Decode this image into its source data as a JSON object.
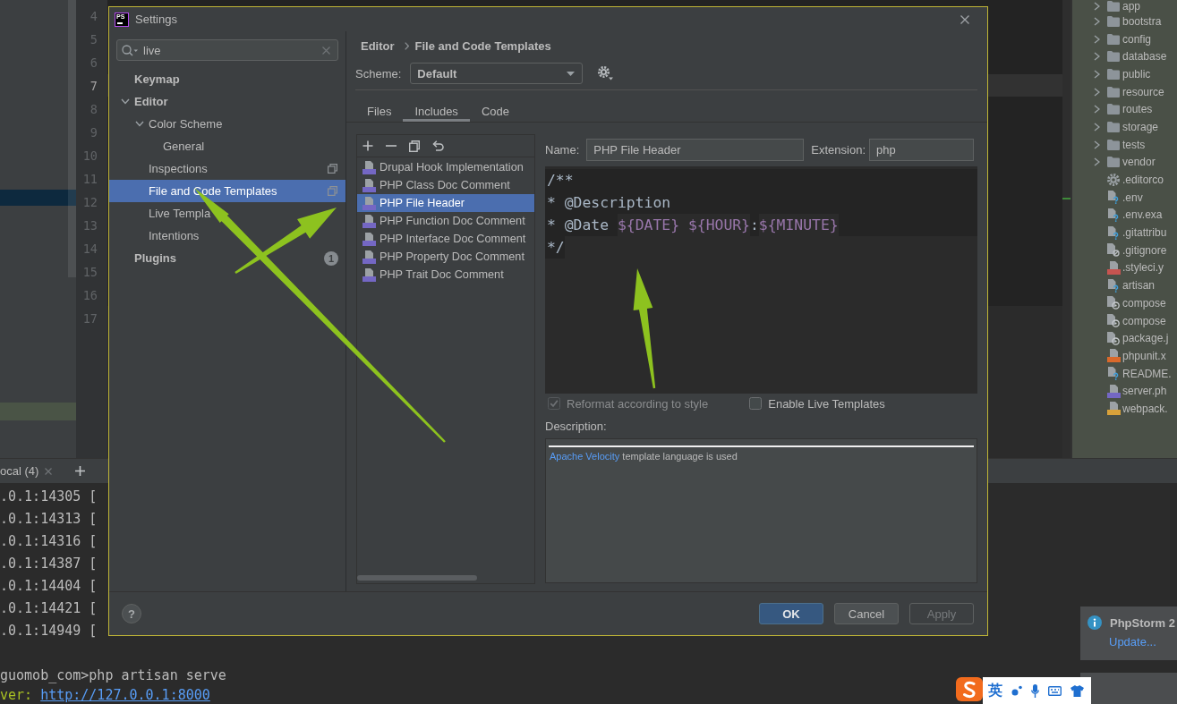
{
  "ide": {
    "gutter": {
      "line_numbers": [
        {
          "number": "4",
          "current": false
        },
        {
          "number": "5",
          "current": false
        },
        {
          "number": "6",
          "current": false
        },
        {
          "number": "7",
          "current": true
        },
        {
          "number": "8",
          "current": false
        },
        {
          "number": "9",
          "current": false
        },
        {
          "number": "10",
          "current": false
        },
        {
          "number": "11",
          "current": false
        },
        {
          "number": "12",
          "current": false
        },
        {
          "number": "13",
          "current": false
        },
        {
          "number": "14",
          "current": false
        },
        {
          "number": "15",
          "current": false
        },
        {
          "number": "16",
          "current": false
        },
        {
          "number": "17",
          "current": false
        }
      ]
    },
    "project_tree": {
      "items": [
        {
          "label": "app",
          "kind": "folder",
          "expanded": false
        },
        {
          "label": "bootstra",
          "kind": "folder",
          "expanded": false
        },
        {
          "label": "config",
          "kind": "folder",
          "expanded": false
        },
        {
          "label": "database",
          "kind": "folder",
          "expanded": false
        },
        {
          "label": "public",
          "kind": "folder",
          "expanded": false
        },
        {
          "label": "resource",
          "kind": "folder",
          "expanded": false
        },
        {
          "label": "routes",
          "kind": "folder",
          "expanded": false
        },
        {
          "label": "storage",
          "kind": "folder",
          "expanded": false
        },
        {
          "label": "tests",
          "kind": "folder",
          "expanded": false
        },
        {
          "label": "vendor",
          "kind": "folder",
          "expanded": false
        },
        {
          "label": ".editorco",
          "kind": "settings"
        },
        {
          "label": ".env",
          "kind": "unknown"
        },
        {
          "label": ".env.exa",
          "kind": "unknown"
        },
        {
          "label": ".gitattribu",
          "kind": "unknown"
        },
        {
          "label": ".gitignore",
          "kind": "ignored"
        },
        {
          "label": ".styleci.y",
          "kind": "yaml"
        },
        {
          "label": "artisan",
          "kind": "unknown"
        },
        {
          "label": "compose",
          "kind": "json"
        },
        {
          "label": "compose",
          "kind": "json"
        },
        {
          "label": "package.j",
          "kind": "json"
        },
        {
          "label": "phpunit.x",
          "kind": "xml"
        },
        {
          "label": "README.",
          "kind": "unknown"
        },
        {
          "label": "server.ph",
          "kind": "php"
        },
        {
          "label": "webpack.",
          "kind": "js"
        }
      ]
    },
    "terminal": {
      "tab": "ocal (4)",
      "output_lines": [
        ".0.1:14305 [",
        ".0.1:14313 [",
        ".0.1:14316 [",
        ".0.1:14387 [",
        ".0.1:14404 [",
        ".0.1:14421 [",
        ".0.1:14949 ["
      ],
      "prompt_line": "guomob_com>php artisan serve",
      "server_line": {
        "label": "ver:",
        "url": "http://127.0.0.1:8000"
      }
    }
  },
  "dialog": {
    "logo": "PS",
    "title": "Settings",
    "search": {
      "value": "live"
    },
    "sidebar": {
      "items": [
        {
          "label": "Keymap",
          "selected": false,
          "project_scope": false
        },
        {
          "label": "Editor",
          "selected": false,
          "project_scope": false,
          "expanded": true,
          "children": [
            {
              "label": "Color Scheme",
              "selected": false,
              "project_scope": false,
              "expanded": true,
              "children": [
                {
                  "label": "General",
                  "selected": false,
                  "project_scope": false
                }
              ]
            },
            {
              "label": "Inspections",
              "selected": false,
              "project_scope": true
            },
            {
              "label": "File and Code Templates",
              "selected": true,
              "project_scope": true
            },
            {
              "label": "Live Templa",
              "selected": false,
              "project_scope": false
            },
            {
              "label": "Intentions",
              "selected": false,
              "project_scope": false
            }
          ]
        },
        {
          "label": "Plugins",
          "selected": false,
          "project_scope": false,
          "badge": "1"
        }
      ]
    },
    "breadcrumb": [
      "Editor",
      "File and Code Templates"
    ],
    "scheme": {
      "label": "Scheme:",
      "value": "Default"
    },
    "tabs": [
      {
        "label": "Files",
        "selected": false
      },
      {
        "label": "Includes",
        "selected": true
      },
      {
        "label": "Code",
        "selected": false
      }
    ],
    "templates": {
      "items": [
        {
          "label": "Drupal Hook Implementation",
          "selected": false
        },
        {
          "label": "PHP Class Doc Comment",
          "selected": false
        },
        {
          "label": "PHP File Header",
          "selected": true
        },
        {
          "label": "PHP Function Doc Comment",
          "selected": false
        },
        {
          "label": "PHP Interface Doc Comment",
          "selected": false
        },
        {
          "label": "PHP Property Doc Comment",
          "selected": false
        },
        {
          "label": "PHP Trait Doc Comment",
          "selected": false
        }
      ]
    },
    "name_field": {
      "label": "Name:",
      "value": "PHP File Header"
    },
    "extension_field": {
      "label": "Extension:",
      "value": "php"
    },
    "template_code": [
      {
        "segments": [
          {
            "kind": "text",
            "text": "/**"
          }
        ]
      },
      {
        "segments": [
          {
            "kind": "text",
            "text": "* @Description"
          }
        ]
      },
      {
        "segments": [
          {
            "kind": "text",
            "text": "* @Date "
          },
          {
            "kind": "variable",
            "text": "${DATE} "
          },
          {
            "kind": "variable",
            "text": "${HOUR}"
          },
          {
            "kind": "text",
            "text": ":"
          },
          {
            "kind": "variable",
            "text": "${MINUTE}"
          }
        ]
      },
      {
        "segments": [
          {
            "kind": "text",
            "text": "*/"
          }
        ]
      }
    ],
    "options": [
      {
        "label": "Reformat according to style",
        "checked": true,
        "disabled": true
      },
      {
        "label": "Enable Live Templates",
        "checked": false,
        "disabled": false
      }
    ],
    "description": {
      "label": "Description:",
      "link": "Apache Velocity",
      "text": "template language is used"
    },
    "help": "?",
    "buttons": [
      {
        "label": "OK",
        "kind": "default",
        "disabled": false
      },
      {
        "label": "Cancel",
        "kind": "normal",
        "disabled": false
      },
      {
        "label": "Apply",
        "kind": "normal",
        "disabled": true
      }
    ]
  },
  "notifications": [
    {
      "title": "PhpStorm 2",
      "link": "Update..."
    }
  ],
  "ime_bar": {
    "mode": "英"
  }
}
